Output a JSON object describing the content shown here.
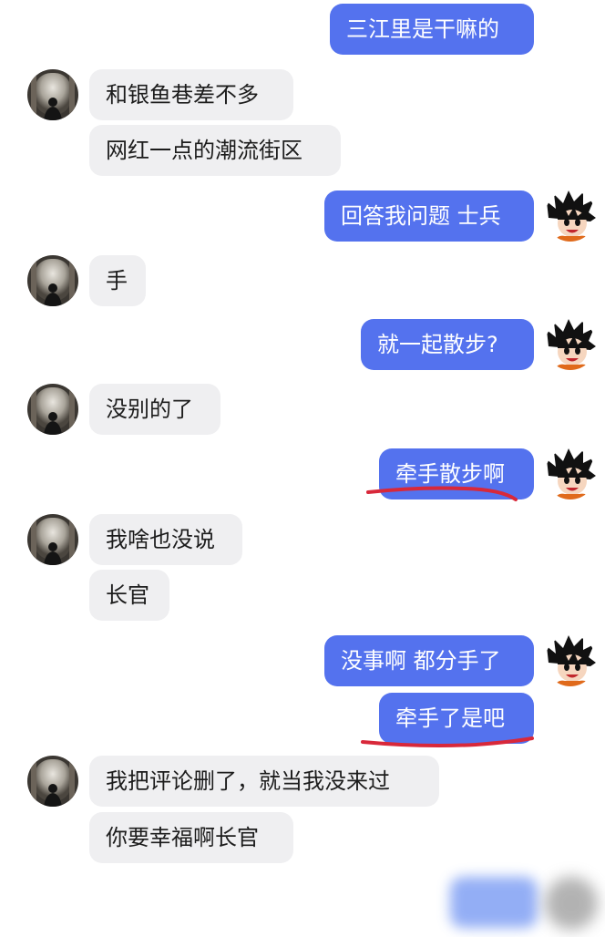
{
  "messages": [
    {
      "text": "三江里是干嘛的"
    },
    {
      "text": "和银鱼巷差不多"
    },
    {
      "text": "网红一点的潮流街区"
    },
    {
      "text": "回答我问题 士兵"
    },
    {
      "text": "手"
    },
    {
      "text": "就一起散步?"
    },
    {
      "text": "没别的了"
    },
    {
      "text": "牵手散步啊"
    },
    {
      "text": "我啥也没说"
    },
    {
      "text": "长官"
    },
    {
      "text": "没事啊 都分手了"
    },
    {
      "text": "牵手了是吧"
    },
    {
      "text": "我把评论删了，就当我没来过"
    },
    {
      "text": "你要幸福啊长官"
    }
  ],
  "colors": {
    "incoming_bubble": "#efeff1",
    "outgoing_bubble": "#5472ee",
    "annotation_red": "#d8283a"
  },
  "icons": {
    "left_avatar": "silhouette-avatar-icon",
    "right_avatar": "cartoon-boy-avatar-icon"
  }
}
